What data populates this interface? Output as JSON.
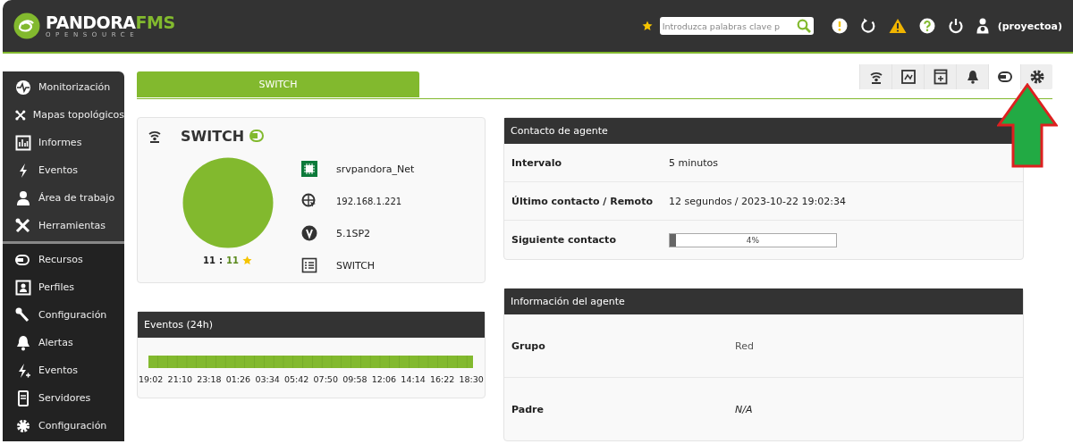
{
  "header": {
    "logo": {
      "brand": "PANDORA",
      "brand_accent": "FMS",
      "edition": "OPENSOURCE"
    },
    "search": {
      "placeholder": "Introduzca palabras clave p"
    },
    "user": "(proyectoa)"
  },
  "sidebar": {
    "sections": [
      {
        "items": [
          "Monitorización",
          "Mapas topológicos",
          "Informes",
          "Eventos",
          "Área de trabajo",
          "Herramientas"
        ]
      },
      {
        "items": [
          "Recursos",
          "Perfiles",
          "Configuración",
          "Alertas",
          "Eventos",
          "Servidores",
          "Configuración"
        ]
      }
    ]
  },
  "tabs": [
    {
      "label": "SWITCH",
      "selected": true
    }
  ],
  "toolbar": [
    {
      "selected": false
    },
    {
      "selected": false
    },
    {
      "selected": false
    },
    {
      "selected": false
    },
    {
      "selected": true
    },
    {
      "selected": false
    }
  ],
  "agent": {
    "name": "SWITCH",
    "modules_total": "11",
    "separator": ":",
    "modules_ok": "11",
    "details": [
      "srvpandora_Net",
      "192.168.1.221",
      "5.1SP2",
      "SWITCH"
    ]
  },
  "events": {
    "title": "Eventos (24h)",
    "time_labels": [
      "19:02",
      "21:10",
      "23:18",
      "01:26",
      "03:34",
      "05:42",
      "07:50",
      "09:58",
      "12:06",
      "14:14",
      "16:22",
      "18:30"
    ]
  },
  "contact": {
    "title": "Contacto de agente",
    "rows": [
      {
        "label": "Intervalo",
        "kind": "text",
        "value": "5 minutos"
      },
      {
        "label": "Último contacto / Remoto",
        "kind": "text",
        "value": "12 segundos / 2023-10-22 19:02:34"
      },
      {
        "label": "Siguiente contacto",
        "kind": "progress",
        "level": 0.04,
        "reading": "4%"
      }
    ]
  },
  "info": {
    "title": "Información del agente",
    "rows": [
      {
        "label": "Grupo",
        "value": "Red",
        "italic": false
      },
      {
        "label": "Padre",
        "value": "N/A",
        "italic": true
      }
    ]
  }
}
